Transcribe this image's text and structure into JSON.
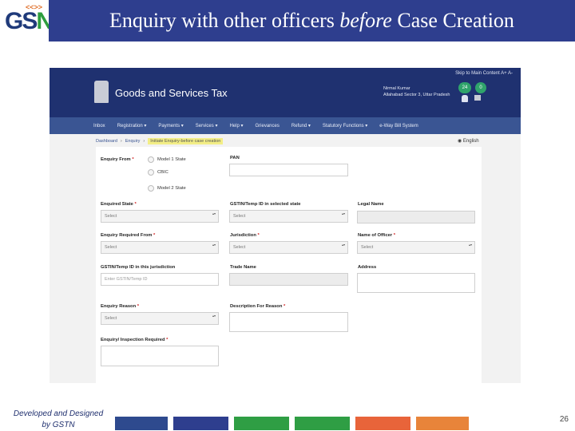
{
  "slide": {
    "title_before": "Enquiry with other officers ",
    "title_italic": "before",
    "title_after": " Case Creation",
    "footer_line1": "Developed and Designed",
    "footer_line2": "by GSTN",
    "page_number": "26",
    "footer_swatch_colors": [
      "#2e4a8e",
      "#2e3e8e",
      "#2f9e44",
      "#2f9e44",
      "#e8643a",
      "#e8843a"
    ]
  },
  "logo": {
    "g": "G",
    "s": "S",
    "n": "N",
    "chevrons": "<<>>"
  },
  "portal": {
    "skip": "Skip to Main Content  A+  A-",
    "site_title": "Goods and Services Tax",
    "user_name": "Nirmal Kumar",
    "user_office": "Allahabad Sector 3, Uttar Pradesh",
    "badge_1": "24",
    "badge_2": "0",
    "colors": {
      "header": "#1f3170",
      "nav": "#3a5593"
    }
  },
  "nav": [
    "Inbox",
    "Registration",
    "Payments",
    "Services",
    "Help",
    "Grievances",
    "Refund",
    "Statutory Functions",
    "e-Way Bill System"
  ],
  "breadcrumb": {
    "dashboard": "Dashboard",
    "enquiry": "Enquiry",
    "current": "Initiate Enquiry-before case creation",
    "sep": "›"
  },
  "language": "English",
  "form": {
    "enquiry_from": {
      "label": "Enquiry From",
      "options": [
        "Model 1 State",
        "CBIC",
        "Model 2 State"
      ]
    },
    "pan": {
      "label": "PAN",
      "value": ""
    },
    "enquired_state": {
      "label": "Enquired State",
      "value": "Select"
    },
    "gstin_selected_state": {
      "label": "GSTIN/Temp ID in selected state",
      "value": "Select"
    },
    "legal_name": {
      "label": "Legal Name",
      "value": ""
    },
    "enquiry_required_from": {
      "label": "Enquiry Required From",
      "value": "Select"
    },
    "jurisdiction": {
      "label": "Jurisdiction",
      "value": "Select"
    },
    "name_of_officer": {
      "label": "Name of Officer",
      "value": "Select"
    },
    "gstin_jurisdiction": {
      "label": "GSTIN/Temp ID in this jurisdiction",
      "placeholder": "Enter GSTIN/Temp ID"
    },
    "trade_name": {
      "label": "Trade Name",
      "value": ""
    },
    "address": {
      "label": "Address",
      "value": ""
    },
    "enquiry_reason": {
      "label": "Enquiry Reason",
      "value": "Select"
    },
    "description_reason": {
      "label": "Description For Reason",
      "value": ""
    },
    "enquiry_inspection": {
      "label": "Enquiry/ Inspection Required",
      "value": ""
    },
    "required_marker": "*"
  }
}
